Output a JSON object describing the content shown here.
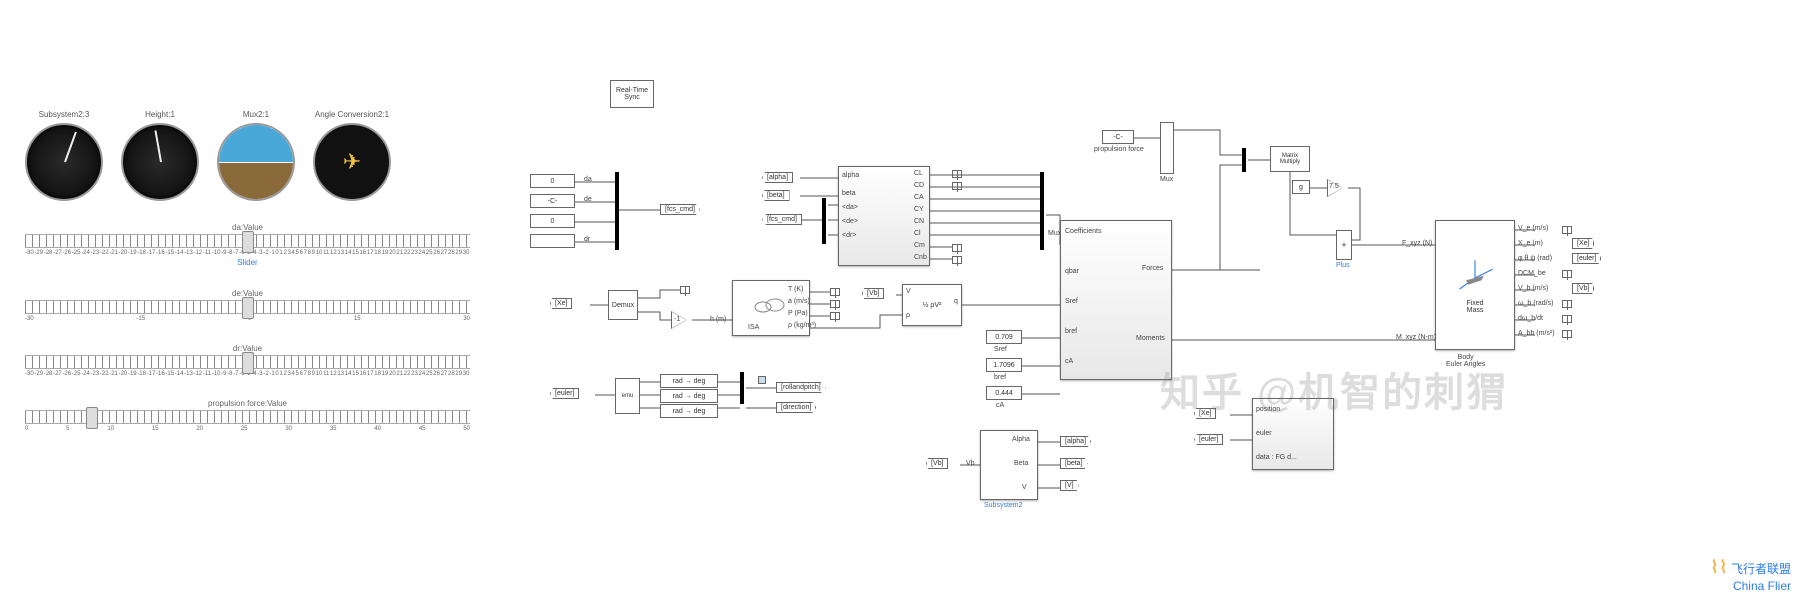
{
  "gauges": [
    {
      "label": "Subsystem2:3",
      "type": "airspeed"
    },
    {
      "label": "Height:1",
      "type": "altimeter"
    },
    {
      "label": "Mux2:1",
      "type": "attitude"
    },
    {
      "label": "Angle Conversion2:1",
      "type": "heading"
    }
  ],
  "sliders": {
    "da": {
      "title": "da:Value",
      "link": "Slider",
      "min": -30,
      "max": 30,
      "pos": 50
    },
    "de": {
      "title": "de:Value",
      "min": -30,
      "max": 30,
      "pos": 50,
      "scale": [
        "-30",
        "-15",
        "0",
        "15",
        "30"
      ]
    },
    "dr": {
      "title": "dr:Value",
      "min": -30,
      "max": 30,
      "pos": 50
    },
    "prop": {
      "title": "propulsion force:Value",
      "min": 0,
      "max": 50,
      "pos": 15,
      "scale": [
        "0",
        "5",
        "10",
        "15",
        "20",
        "25",
        "30",
        "35",
        "40",
        "45",
        "50"
      ]
    }
  },
  "slider_dense_scale": [
    "-30",
    "-29",
    "-28",
    "-27",
    "-26",
    "-25",
    "-24",
    "-23",
    "-22",
    "-21",
    "-20",
    "-19",
    "-18",
    "-17",
    "-16",
    "-15",
    "-14",
    "-13",
    "-12",
    "-11",
    "-10",
    "-9",
    "-8",
    "-7",
    "-6",
    "-5",
    "-4",
    "-3",
    "-2",
    "-1",
    "0",
    "1",
    "2",
    "3",
    "4",
    "5",
    "6",
    "7",
    "8",
    "9",
    "10",
    "11",
    "12",
    "13",
    "14",
    "15",
    "16",
    "17",
    "18",
    "19",
    "20",
    "21",
    "22",
    "23",
    "24",
    "25",
    "26",
    "27",
    "28",
    "29",
    "30"
  ],
  "rt_sync": "Real-Time\nSync",
  "fcs_inputs": [
    {
      "value": "0",
      "name": "da"
    },
    {
      "value": "-C-",
      "name": "de"
    },
    {
      "value": "0",
      "name": ""
    },
    {
      "value": "",
      "name": "dr"
    }
  ],
  "fcs_goto": "[fcs_cmd]",
  "from_xe": "[Xe]",
  "from_euler": "[euler]",
  "demux": "Demux",
  "gain_neg1": "-1",
  "rad2deg": "rad → deg",
  "goto_rollpitch": "[rollandpitch]",
  "goto_direction": "[direction]",
  "isa": {
    "title": "ISA",
    "in": "h (m)",
    "outs": [
      "T (K)",
      "a (m/s)",
      "P (Pa)",
      "ρ (kg/m³)"
    ]
  },
  "dynpress": {
    "formula": "½ ρV²",
    "in1": "V",
    "in2": "ρ",
    "out": "q"
  },
  "aero_in_tags": {
    "alpha": "[alpha]",
    "beta": "[beta]",
    "fcs": "[fcs_cmd]"
  },
  "aero_in_ports": [
    "alpha",
    "beta",
    "<da>",
    "<de>",
    "<dr>"
  ],
  "aero_out_ports": [
    "CL",
    "CD",
    "CA",
    "CY",
    "CN",
    "Cl",
    "Cm",
    "Cnb"
  ],
  "from_vb": "[Vb]",
  "consts": {
    "sref": "0.709",
    "bref": "1.7096",
    "cA": "0.444"
  },
  "consts_labels": {
    "sref": "Sref",
    "bref": "bref",
    "cA": "cA"
  },
  "forces_block": {
    "ins": [
      "Coefficients",
      "qbar",
      "Sref",
      "bref",
      "cA"
    ],
    "outs": [
      "Forces",
      "Moments"
    ]
  },
  "prop_const": "-C-",
  "prop_label": "propulsion force",
  "mux_label": "Mux",
  "matmul": "Matrix\nMultiply",
  "g_const": "g",
  "g_gain": "7.5",
  "plus_label": "Plus",
  "sixdof": {
    "title": "Fixed\nMass",
    "sub": "Body\nEuler Angles",
    "in1": "F_xyz (N)",
    "in2": "M_xyz (N-m)",
    "outs": [
      "V_e (m/s)",
      "X_e (m)",
      "φ θ ψ (rad)",
      "DCM_be",
      "V_b (m/s)",
      "ω_b (rad/s)",
      "dω_b/dt",
      "A_bb (m/s²)"
    ]
  },
  "out_tags": {
    "xe": "[Xe]",
    "euler": "[euler]",
    "vb": "[Vb]"
  },
  "sub2": {
    "title": "Subsystem2",
    "ins": [
      "Alpha",
      "Beta",
      "V"
    ],
    "in_src": "Vb",
    "outs": [
      "[alpha]",
      "[beta]",
      "[V]"
    ]
  },
  "viz_block": {
    "ins": [
      "position",
      "euler",
      "data : FG d..."
    ],
    "srcs": [
      "[Xe]",
      "[euler]"
    ]
  },
  "watermark": "知乎 @机智的刺猬",
  "logo": {
    "cn": "飞行者联盟",
    "en": "China Flier"
  }
}
